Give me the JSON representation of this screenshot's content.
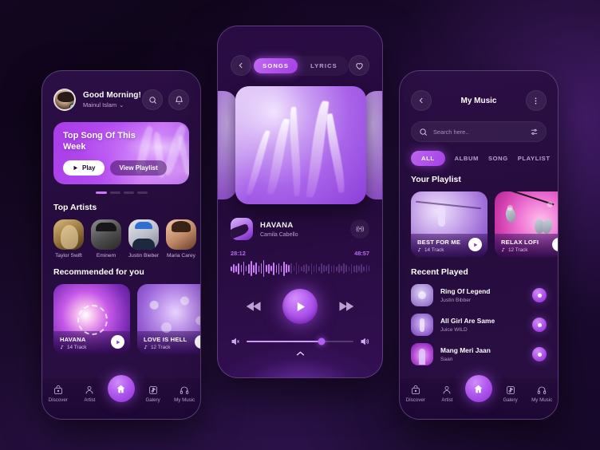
{
  "left_phone": {
    "greeting": "Good Morning!",
    "user_name": "Mainul Islam",
    "search_icon": "search-icon",
    "bell_icon": "bell-icon",
    "banner": {
      "title": "Top Song Of This Week",
      "play_label": "Play",
      "view_label": "View Playlist",
      "dots_total": 4,
      "dots_active": 1
    },
    "sections": {
      "artists_title": "Top Artists",
      "recommended_title": "Recommended for you"
    },
    "artists": [
      {
        "name": "Taylor Swift"
      },
      {
        "name": "Eminem"
      },
      {
        "name": "Justin Bieber"
      },
      {
        "name": "Maria Carey"
      }
    ],
    "recommended": [
      {
        "title": "HAVANA",
        "tracks": "14 Track"
      },
      {
        "title": "LOVE IS HELL",
        "tracks": "12 Track"
      }
    ]
  },
  "center_phone": {
    "back_icon": "chevron-left-icon",
    "heart_icon": "heart-icon",
    "tabs": [
      {
        "label": "SONGS",
        "active": true
      },
      {
        "label": "LYRICS",
        "active": false
      }
    ],
    "now_playing": {
      "title": "HAVANA",
      "artist": "Camila Cabello",
      "cast_icon": "cast-icon",
      "elapsed": "28:12",
      "duration": "48:57",
      "progress_percent": 42,
      "volume_percent": 70
    },
    "controls": {
      "rewind_icon": "rewind-icon",
      "play_icon": "play-icon",
      "forward_icon": "forward-icon",
      "volume_mute_icon": "volume-mute-icon",
      "volume_up_icon": "volume-up-icon",
      "expand_icon": "chevron-up-icon"
    }
  },
  "right_phone": {
    "back_icon": "chevron-left-icon",
    "title": "My Music",
    "more_icon": "more-vertical-icon",
    "search": {
      "placeholder": "Search here..",
      "value": "",
      "filter_icon": "filter-icon"
    },
    "chips": [
      {
        "label": "ALL",
        "active": true
      },
      {
        "label": "ALBUM",
        "active": false
      },
      {
        "label": "SONG",
        "active": false
      },
      {
        "label": "PLAYLIST",
        "active": false
      }
    ],
    "playlist_title": "Your Playlist",
    "playlists": [
      {
        "title": "BEST FOR ME",
        "tracks": "14 Track"
      },
      {
        "title": "RELAX LOFI",
        "tracks": "12 Track"
      }
    ],
    "recent_title": "Recent Played",
    "recent": [
      {
        "title": "Ring Of Legend",
        "artist": "Justin Bibber"
      },
      {
        "title": "All Girl Are Same",
        "artist": "Juice WILD"
      },
      {
        "title": "Mang Meri Jaan",
        "artist": "Saan"
      }
    ]
  },
  "bottom_nav": [
    {
      "label": "Discover",
      "icon": "discover-icon"
    },
    {
      "label": "Artist",
      "icon": "artist-icon"
    },
    {
      "label": "",
      "icon": "home-icon"
    },
    {
      "label": "Galery",
      "icon": "gallery-icon"
    },
    {
      "label": "My Music",
      "icon": "headphone-icon"
    }
  ],
  "colors": {
    "accent": "#b45cf0",
    "accent_light": "#d08cf8",
    "bg": "#0d0415",
    "panel": "#2b0f45"
  }
}
